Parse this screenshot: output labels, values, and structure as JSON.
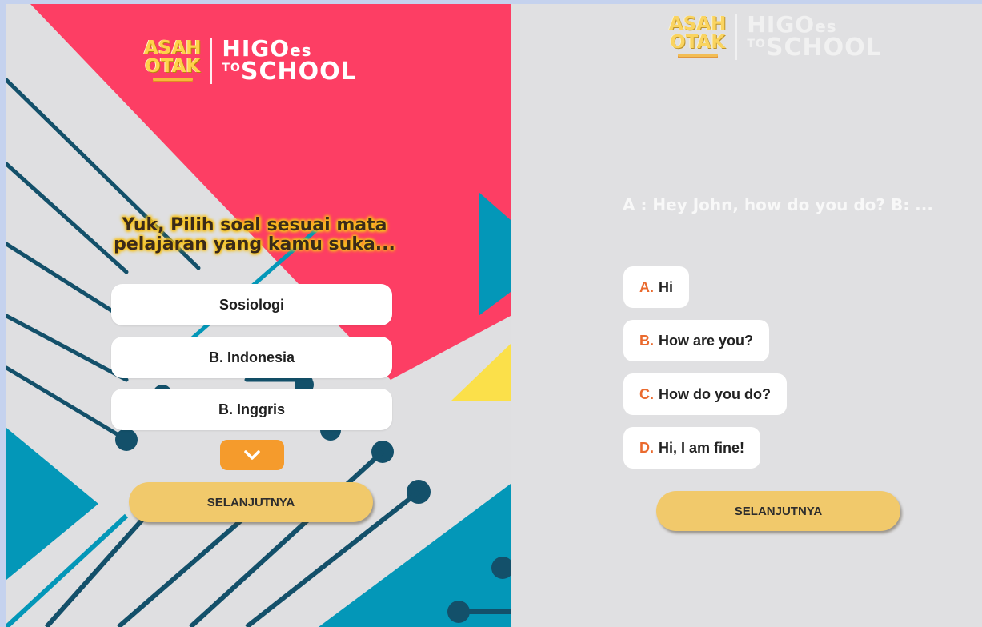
{
  "left_panel": {
    "logo": {
      "asah": "ASAH",
      "otak": "OTAK",
      "higo": "HIGO",
      "es": "es",
      "to": "TO",
      "school": "SCHOOL"
    },
    "prompt": "Yuk, Pilih soal sesuai mata pelajaran yang kamu suka...",
    "subjects": [
      "Sosiologi",
      "B. Indonesia",
      "B. Inggris"
    ],
    "scroll_icon": "chevron-down-icon",
    "next_label": "SELANJUTNYA"
  },
  "right_panel": {
    "logo": {
      "asah": "ASAH",
      "otak": "OTAK",
      "higo": "HIGO",
      "es": "es",
      "to": "TO",
      "school": "SCHOOL"
    },
    "question": "A : Hey John, how do you do? B: ...",
    "answers": [
      {
        "letter": "A.",
        "text": "Hi"
      },
      {
        "letter": "B.",
        "text": "How are you?"
      },
      {
        "letter": "C.",
        "text": "How do you do?"
      },
      {
        "letter": "D.",
        "text": "Hi, I am fine!"
      }
    ],
    "next_label": "SELANJUTNYA"
  },
  "colors": {
    "pink": "#fd3e64",
    "teal": "#0397b8",
    "navy_line": "#13506a",
    "yellow": "#fbe04a",
    "button_gold": "#f1c96b",
    "scroll_orange": "#f59b2c",
    "answer_letter": "#ea6a2e"
  }
}
